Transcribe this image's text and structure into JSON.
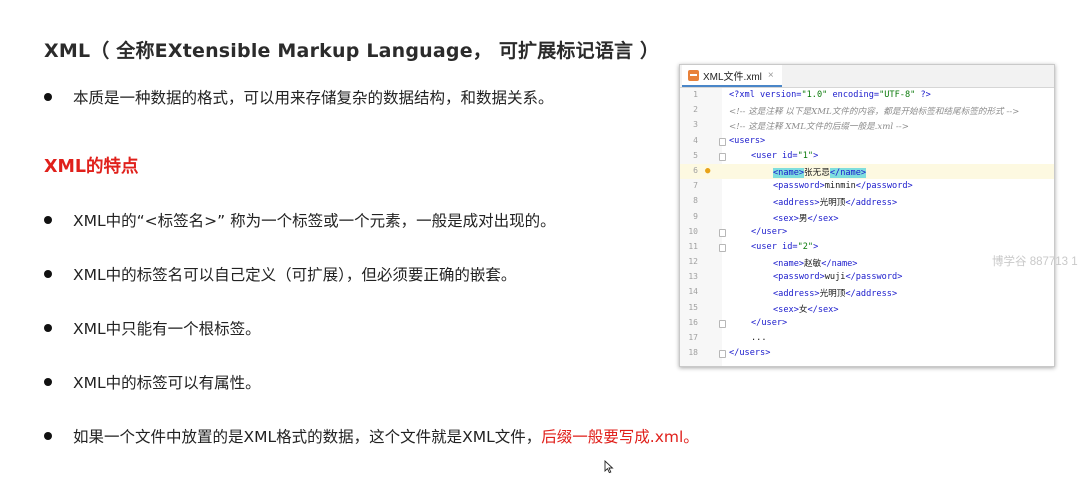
{
  "title": "XML（ 全称EXtensible Markup Language， 可扩展标记语言 ）",
  "intro": "本质是一种数据的格式，可以用来存储复杂的数据结构，和数据关系。",
  "section_title": "XML的特点",
  "bullets": [
    "XML中的“<标签名>” 称为一个标签或一个元素，一般是成对出现的。",
    "XML中的标签名可以自己定义（可扩展），但必须要正确的嵌套。",
    "XML中只能有一个根标签。",
    "XML中的标签可以有属性。"
  ],
  "last_bullet": {
    "text": "如果一个文件中放置的是XML格式的数据，这个文件就是XML文件，",
    "highlight": "后缀一般要写成.xml。"
  },
  "editor": {
    "tab_name": "XML文件.xml",
    "tab_close": "×",
    "line_numbers": [
      "1",
      "2",
      "3",
      "4",
      "5",
      "6",
      "7",
      "8",
      "9",
      "10",
      "11",
      "12",
      "13",
      "14",
      "15",
      "16",
      "17",
      "18"
    ],
    "lines": {
      "l1_a": "<?xml",
      "l1_b": " version=",
      "l1_c": "\"1.0\"",
      "l1_d": " encoding=",
      "l1_e": "\"UTF-8\"",
      "l1_f": " ?>",
      "l2": "<!-- 这是注释 以下是XML文件的内容，都是开始标签和结尾标签的形式 -->",
      "l3": "<!-- 这是注释 XML文件的后缀一般是.xml -->",
      "l4": "<users>",
      "l5_a": "<user",
      "l5_b": " id=",
      "l5_c": "\"1\"",
      "l5_d": ">",
      "l6_a": "<name>",
      "l6_b": "张无忌",
      "l6_c": "</name>",
      "l7_a": "<password>",
      "l7_b": "minmin",
      "l7_c": "</password>",
      "l8_a": "<address>",
      "l8_b": "光明顶",
      "l8_c": "</address>",
      "l9_a": "<sex>",
      "l9_b": "男",
      "l9_c": "</sex>",
      "l10": "</user>",
      "l11_a": "<user",
      "l11_b": " id=",
      "l11_c": "\"2\"",
      "l11_d": ">",
      "l12_a": "<name>",
      "l12_b": "赵敏",
      "l12_c": "</name>",
      "l13_a": "<password>",
      "l13_b": "wuji",
      "l13_c": "</password>",
      "l14_a": "<address>",
      "l14_b": "光明顶",
      "l14_c": "</address>",
      "l15_a": "<sex>",
      "l15_b": "女",
      "l15_c": "</sex>",
      "l16": "</user>",
      "l17": "...",
      "l18": "</users>"
    },
    "bulb_icon": "lightbulb-icon"
  },
  "watermark": "博学谷 887713 1",
  "colors": {
    "accent_red": "#e0201b",
    "tag_blue": "#1a1acc",
    "string_green": "#0a7a0a"
  }
}
